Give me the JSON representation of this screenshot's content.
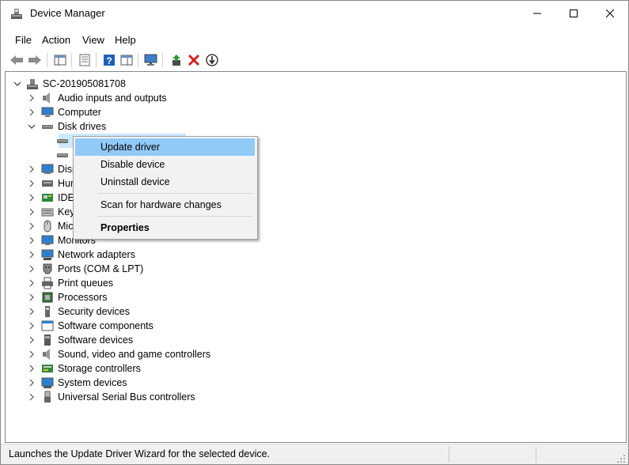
{
  "window": {
    "title": "Device Manager"
  },
  "menu": {
    "file": "File",
    "action": "Action",
    "view": "View",
    "help": "Help"
  },
  "toolbar": {
    "icons": [
      "back-icon",
      "forward-icon",
      "show-hide-console-tree-icon",
      "properties-icon",
      "help-icon",
      "view-icon",
      "monitor-icon",
      "update-driver-icon",
      "uninstall-icon",
      "disable-icon"
    ]
  },
  "tree": {
    "root": "SC-201905081708",
    "items": [
      {
        "label": "Audio inputs and outputs",
        "icon": "speaker-icon"
      },
      {
        "label": "Computer",
        "icon": "computer-icon"
      },
      {
        "label": "Disk drives",
        "icon": "disk-drive-icon"
      },
      {
        "label": "Disp",
        "icon": "display-adapter-icon"
      },
      {
        "label": "Hun",
        "icon": "hid-icon"
      },
      {
        "label": "IDE",
        "icon": "ide-controller-icon"
      },
      {
        "label": "Key",
        "icon": "keyboard-icon"
      },
      {
        "label": "Mic",
        "icon": "mouse-icon"
      },
      {
        "label": "Monitors",
        "icon": "monitor-icon"
      },
      {
        "label": "Network adapters",
        "icon": "network-adapter-icon"
      },
      {
        "label": "Ports (COM & LPT)",
        "icon": "port-icon"
      },
      {
        "label": "Print queues",
        "icon": "printer-icon"
      },
      {
        "label": "Processors",
        "icon": "processor-icon"
      },
      {
        "label": "Security devices",
        "icon": "security-device-icon"
      },
      {
        "label": "Software components",
        "icon": "software-component-icon"
      },
      {
        "label": "Software devices",
        "icon": "software-device-icon"
      },
      {
        "label": "Sound, video and game controllers",
        "icon": "sound-icon"
      },
      {
        "label": "Storage controllers",
        "icon": "storage-controller-icon"
      },
      {
        "label": "System devices",
        "icon": "system-device-icon"
      },
      {
        "label": "Universal Serial Bus controllers",
        "icon": "usb-icon"
      }
    ]
  },
  "context_menu": {
    "update_driver": "Update driver",
    "disable_device": "Disable device",
    "uninstall_device": "Uninstall device",
    "scan_hardware": "Scan for hardware changes",
    "properties": "Properties"
  },
  "status": {
    "text": "Launches the Update Driver Wizard for the selected device."
  },
  "colors": {
    "selection": "#cce8ff",
    "menu_highlight": "#91c9f7",
    "menu_bg": "#f2f2f2"
  }
}
